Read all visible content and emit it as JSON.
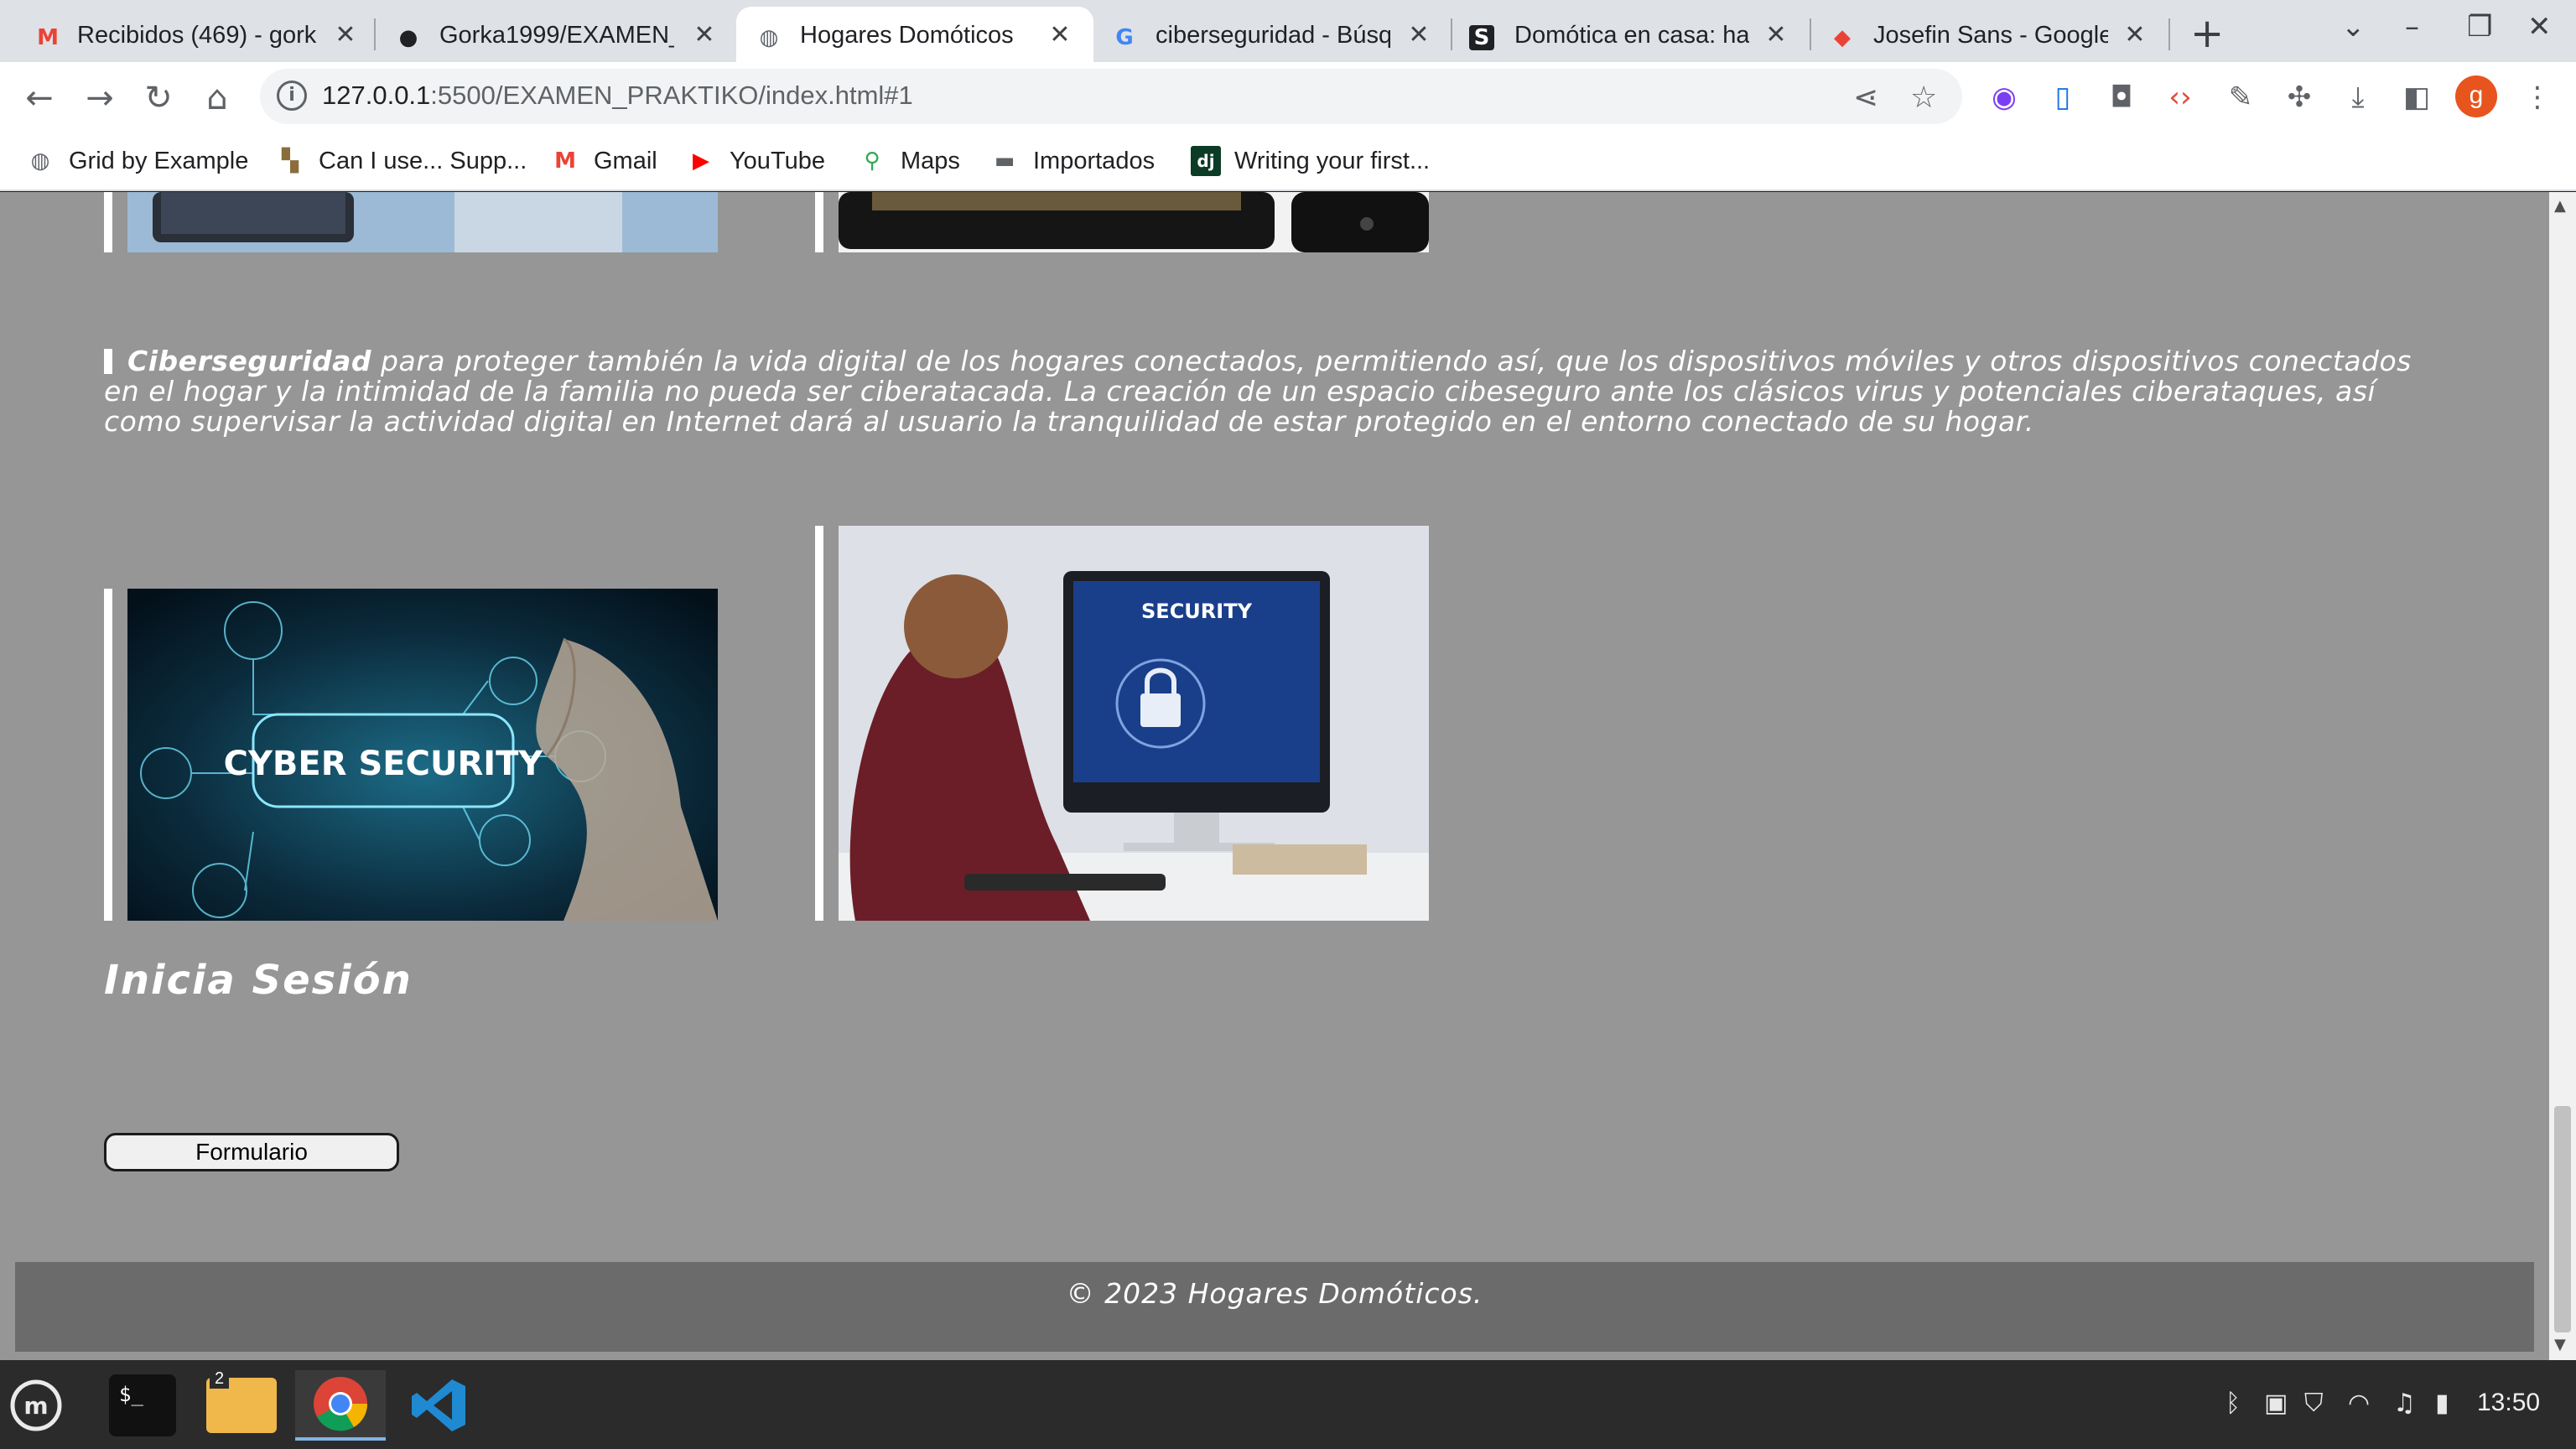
{
  "browser": {
    "tabs": [
      {
        "title": "Recibidos (469) - gork",
        "favicon": "gmail-icon",
        "active": false
      },
      {
        "title": "Gorka1999/EXAMEN_",
        "favicon": "github-icon",
        "active": false
      },
      {
        "title": "Hogares Domóticos",
        "favicon": "globe-icon",
        "active": true
      },
      {
        "title": "ciberseguridad - Búsq",
        "favicon": "google-icon",
        "active": false
      },
      {
        "title": "Domótica en casa: hac",
        "favicon": "s-icon",
        "active": false
      },
      {
        "title": "Josefin Sans - Google",
        "favicon": "google-fonts-icon",
        "active": false
      }
    ],
    "url_host": "127.0.0.1",
    "url_rest": ":5500/EXAMEN_PRAKTIKO/index.html#1",
    "profile_initial": "g",
    "bookmarks": [
      {
        "label": "Grid by Example",
        "icon": "globe-icon"
      },
      {
        "label": "Can I use... Supp...",
        "icon": "caniuse-icon"
      },
      {
        "label": "Gmail",
        "icon": "gmail-icon"
      },
      {
        "label": "YouTube",
        "icon": "youtube-icon"
      },
      {
        "label": "Maps",
        "icon": "maps-icon"
      },
      {
        "label": "Importados",
        "icon": "folder-icon"
      },
      {
        "label": "Writing your first...",
        "icon": "django-icon"
      }
    ]
  },
  "page": {
    "paragraph_strong": "Ciberseguridad",
    "paragraph_rest": " para proteger también la vida digital de los hogares conectados, permitiendo así, que los dispositivos móviles y otros dispositivos conectados en el hogar y la intimidad de la familia no pueda ser ciberatacada. La creación de un espacio cibeseguro ante los clásicos virus y potenciales ciberataques, así como supervisar la actividad digital en Internet dará al usuario la tranquilidad de estar protegido en el entorno conectado de su hogar.",
    "cyber_image_text": "CYBER SECURITY",
    "security_image_text": "SECURITY",
    "login_heading": "Inicia Sesión",
    "form_button": "Formulario",
    "footer_text": "© 2023 Hogares Domóticos.",
    "background": "#969696",
    "footer_bg": "#6b6b6b"
  },
  "taskbar": {
    "files_badge": "2",
    "clock": "13:50"
  }
}
